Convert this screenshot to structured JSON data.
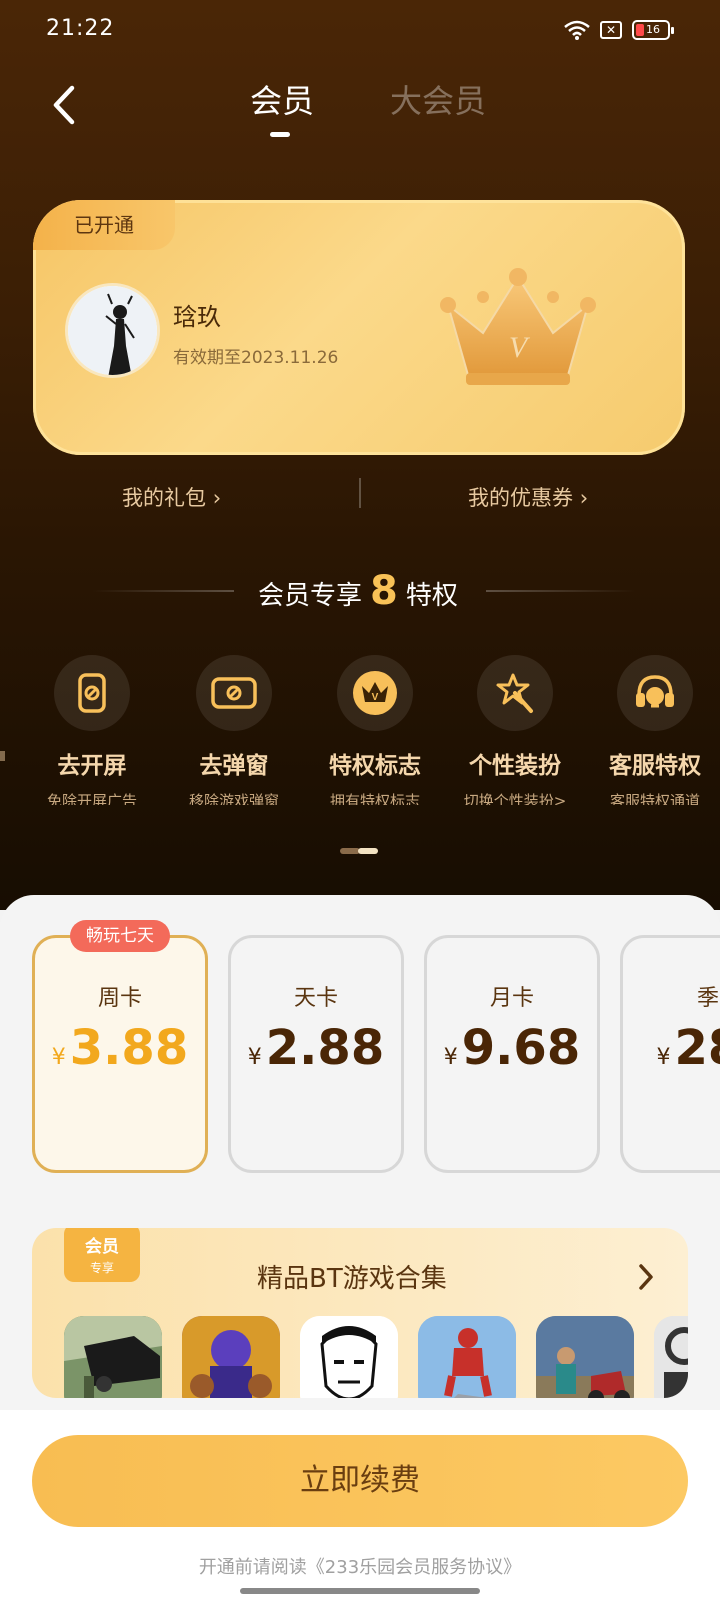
{
  "status_bar": {
    "time": "21:22",
    "battery": "16"
  },
  "nav": {
    "tabs": [
      {
        "label": "会员",
        "active": true
      },
      {
        "label": "大会员",
        "active": false
      }
    ]
  },
  "member_card": {
    "badge": "已开通",
    "user_name": "琀玖",
    "expire_text": "有效期至2023.11.26",
    "crown_letter": "V"
  },
  "links": {
    "gift": "我的礼包",
    "coupon": "我的优惠券"
  },
  "privileges": {
    "title_prefix": "会员专享",
    "count": "8",
    "title_suffix": "特权",
    "items": [
      {
        "name": "去开屏",
        "desc": "免除开屏广告",
        "icon": "phone-icon"
      },
      {
        "name": "去弹窗",
        "desc": "移除游戏弹窗",
        "icon": "popup-icon"
      },
      {
        "name": "特权标志",
        "desc": "拥有特权标志",
        "icon": "crown-badge-icon"
      },
      {
        "name": "个性装扮",
        "desc": "切换个性装扮>",
        "icon": "magic-wand-icon"
      },
      {
        "name": "客服特权",
        "desc": "客服特权通道",
        "icon": "headset-icon"
      }
    ]
  },
  "plans": [
    {
      "tag": "畅玩七天",
      "name": "周卡",
      "currency": "¥",
      "price": "3.88",
      "selected": true
    },
    {
      "tag": "",
      "name": "天卡",
      "currency": "¥",
      "price": "2.88",
      "selected": false
    },
    {
      "tag": "",
      "name": "月卡",
      "currency": "¥",
      "price": "9.68",
      "selected": false
    },
    {
      "tag": "",
      "name": "季",
      "currency": "¥",
      "price": "28.",
      "selected": false
    }
  ],
  "bt_collection": {
    "badge_main": "会员",
    "badge_sub": "专享",
    "title": "精品BT游戏合集"
  },
  "renew_button": "立即续费",
  "agreement": "开通前请阅读《233乐园会员服务协议》",
  "colors": {
    "accent": "#f8bd52",
    "price_selected": "#f2a81d",
    "hero_bg": "#3a1e05"
  }
}
